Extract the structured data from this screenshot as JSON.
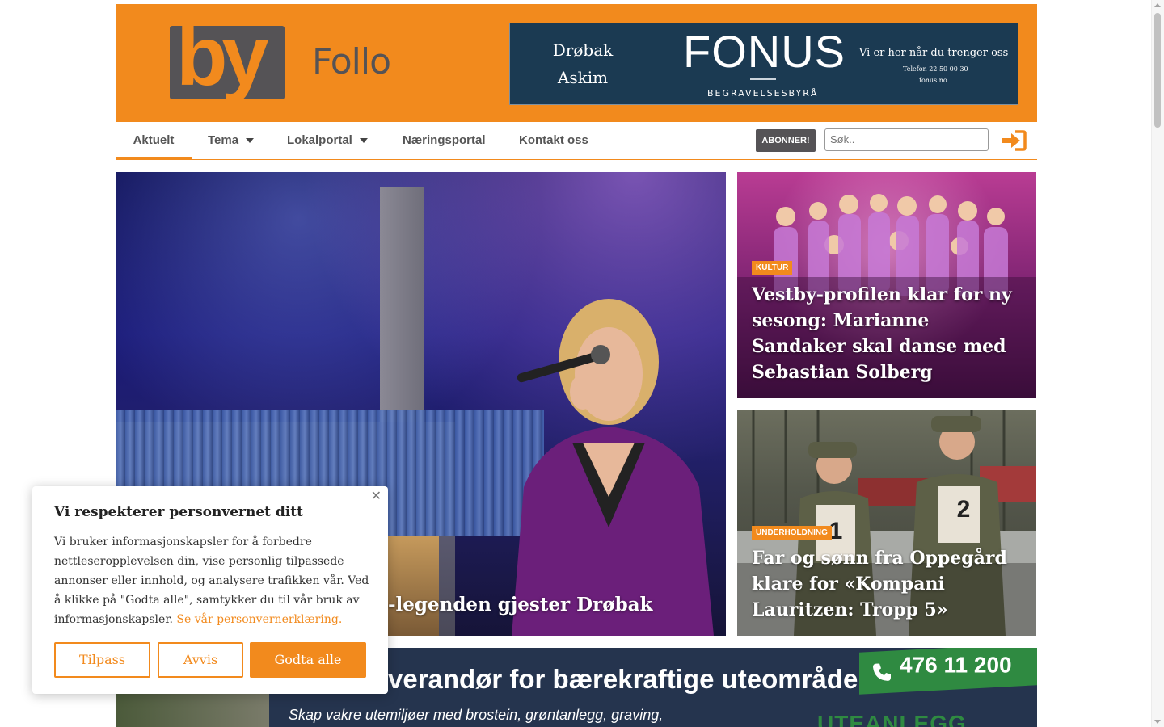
{
  "header": {
    "logo_text": "by",
    "region": "Follo",
    "ad": {
      "places": [
        "Drøbak",
        "Askim"
      ],
      "brand": "FONUS",
      "subtitle": "BEGRAVELSESBYRÅ",
      "tagline": "Vi er her når du trenger oss",
      "phone": "Telefon 22 50 00 30",
      "web": "fonus.no"
    }
  },
  "nav": {
    "items": [
      "Aktuelt",
      "Tema",
      "Lokalportal",
      "Næringsportal",
      "Kontakt oss"
    ],
    "subscribe_label": "ABONNER!",
    "search_placeholder": "Søk.."
  },
  "articles": [
    {
      "headline": "-legenden gjester Drøbak"
    },
    {
      "category": "KULTUR",
      "headline": "Vestby-profilen klar for ny sesong: Marianne Sandaker skal danse med Sebastian Solberg"
    },
    {
      "category": "UNDERHOLDNING",
      "headline": "Far og sønn fra Oppegård klare for «Kompani Lauritzen: Tropp 5»"
    }
  ],
  "banner_ad": {
    "headline": "verandør for bærekraftige uteområder",
    "text": "Skap vakre utemiljøer med brostein, grøntanlegg, graving,",
    "phone": "476 11 200",
    "logo_text": "UTEANLEGG"
  },
  "cookie": {
    "title": "Vi respekterer personvernet ditt",
    "body": "Vi bruker informasjonskapsler for å forbedre nettleseropplevelsen din, vise personlig tilpassede annonser eller innhold, og analysere trafikken vår. Ved å klikke på \"Godta alle\", samtykker du til vår bruk av informasjonskapsler.",
    "link": "Se vår personvernerklæring.",
    "customize": "Tilpass",
    "reject": "Avvis",
    "accept": "Godta alle"
  },
  "colors": {
    "brand_orange": "#f28a1d",
    "logo_gray": "#555356"
  }
}
